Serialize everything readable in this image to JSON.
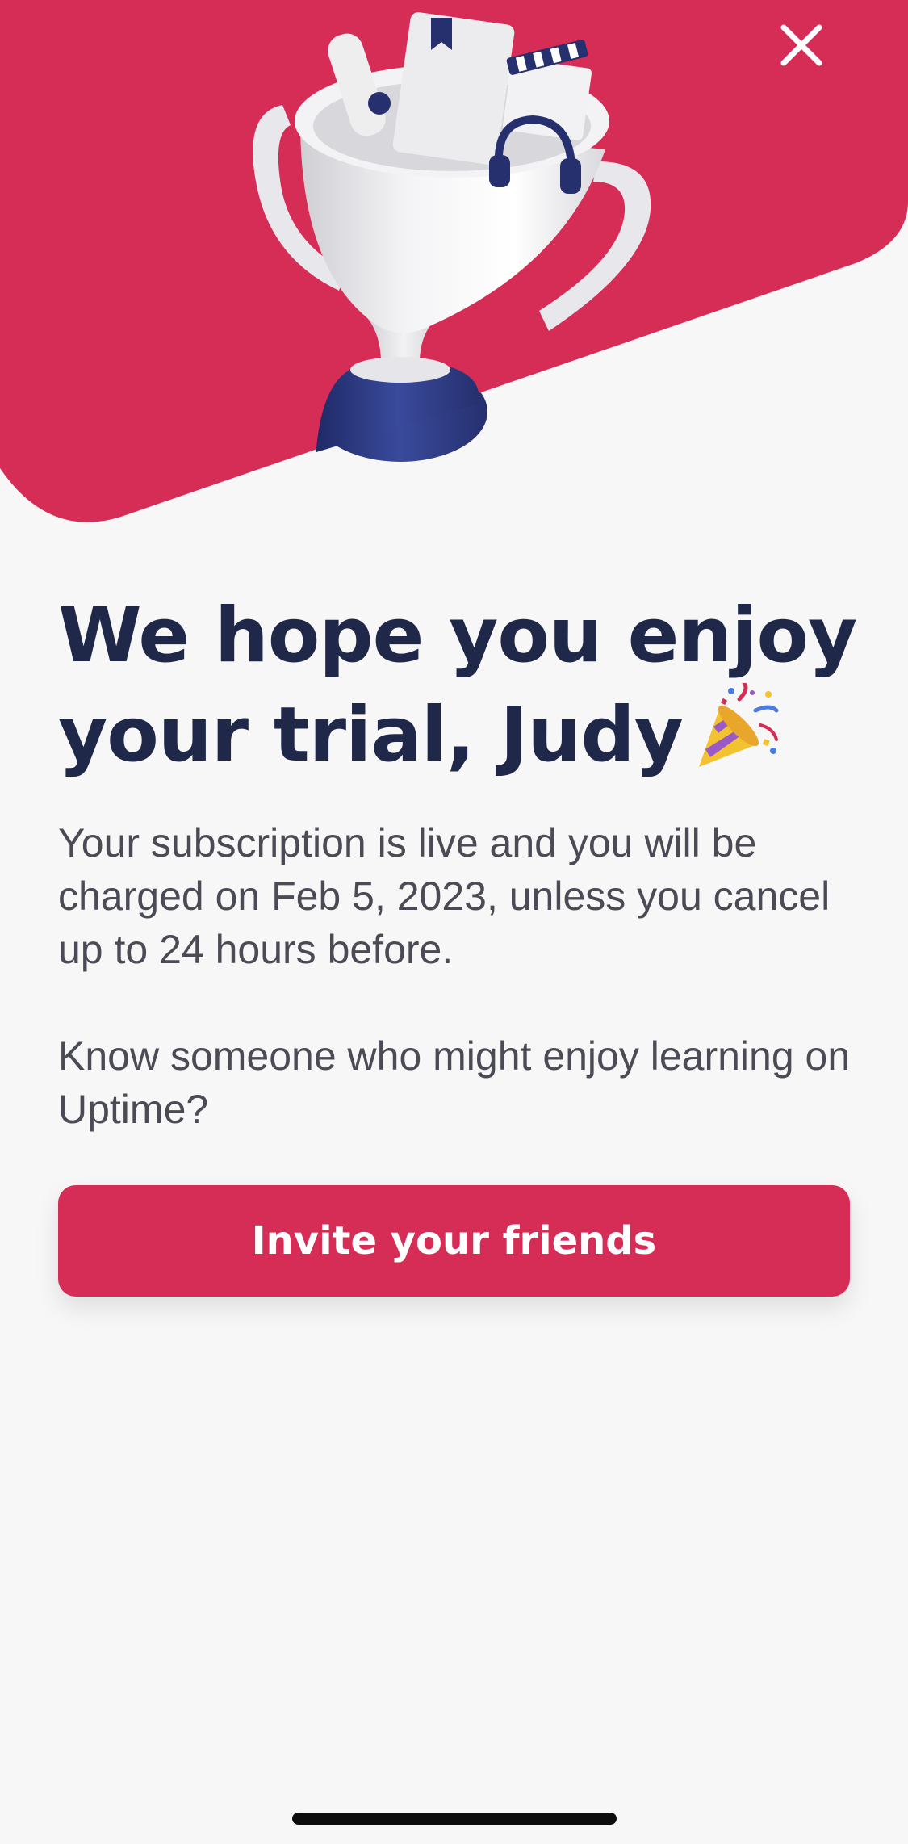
{
  "colors": {
    "accent": "#d62d56",
    "headline": "#1f2848",
    "body_text": "#4b4b55",
    "background": "#f7f7f7"
  },
  "hero": {
    "illustration": "trophy-with-book-scroll-clapperboard-headphones"
  },
  "close_button": {
    "icon": "close-icon"
  },
  "headline": {
    "text": "We hope you enjoy your trial, Judy",
    "emoji": "party-popper-icon"
  },
  "subscription_text": "Your subscription is live and you will be charged on Feb 5, 2023, unless you cancel up to 24 hours before.",
  "referral_text": "Know someone who might enjoy learning on Uptime?",
  "cta": {
    "label": "Invite your friends"
  }
}
